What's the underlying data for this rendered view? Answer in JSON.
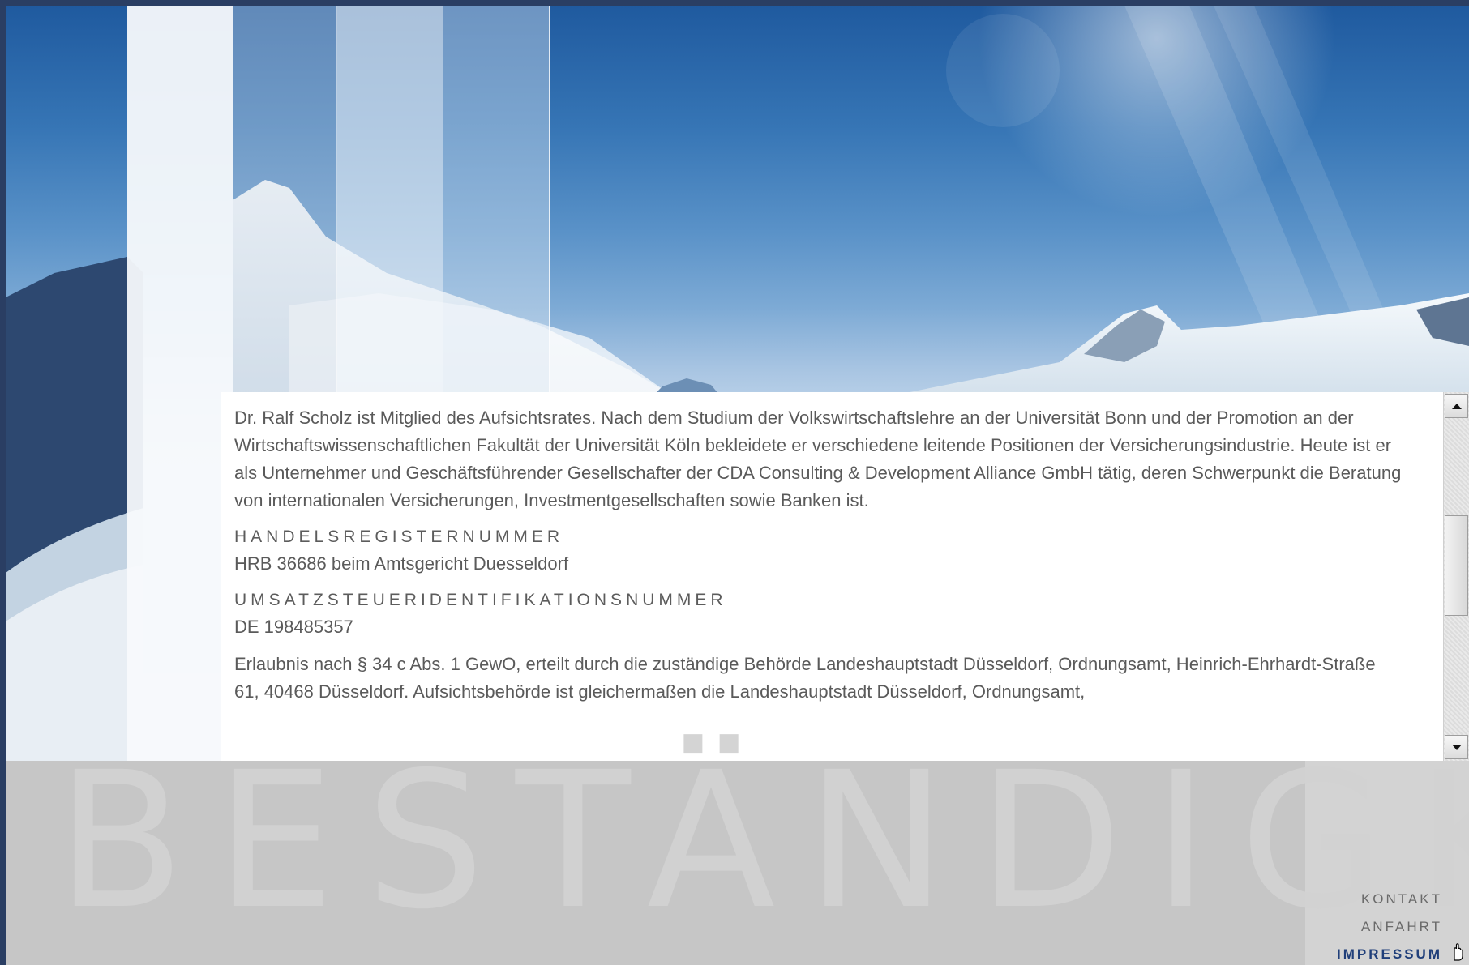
{
  "content": {
    "intro": "Dr. Ralf Scholz ist Mitglied des Aufsichtsrates. Nach dem Studium der Volkswirtschaftslehre an der Universität Bonn und der Promotion an der Wirtschaftswissenschaftlichen Fakultät der Universität Köln bekleidete er verschiedene leitende Positionen der Versicherungsindustrie. Heute ist er als Unternehmer und Geschäftsführender Gesellschafter der CDA Consulting & Development Alliance GmbH tätig, deren Schwerpunkt die Beratung von internationalen Versicherungen, Investmentgesellschaften sowie Banken ist.",
    "register_heading": "HANDELSREGISTERNUMMER",
    "register_value": "HRB 36686 beim Amtsgericht Duesseldorf",
    "vat_heading": "UMSATZSTEUERIDENTIFIKATIONSNUMMER",
    "vat_value": "DE 198485357",
    "permit": "Erlaubnis nach § 34 c Abs. 1 GewO, erteilt durch die zuständige Behörde Landeshauptstadt Düsseldorf, Ordnungsamt, Heinrich-Ehrhardt-Straße 61, 40468 Düsseldorf. Aufsichtsbehörde ist gleichermaßen die Landeshauptstadt Düsseldorf, Ordnungsamt,"
  },
  "footer": {
    "watermark": "BESTÄNDIGKEIT",
    "nav": {
      "kontakt": "KONTAKT",
      "anfahrt": "ANFAHRT",
      "impressum": "IMPRESSUM"
    }
  },
  "colors": {
    "active_nav": "#203f7a",
    "text": "#5a5a5a",
    "footer_bg": "#c6c6c6"
  },
  "icons": {
    "scroll_up": "triangle-up-icon",
    "scroll_down": "triangle-down-icon",
    "cursor": "hand-pointer-icon"
  }
}
